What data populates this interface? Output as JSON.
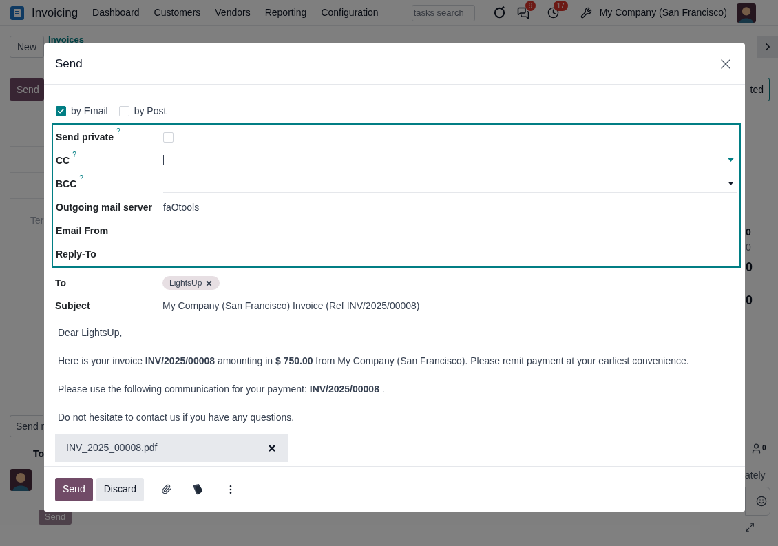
{
  "navbar": {
    "app_name": "Invoicing",
    "menu": [
      "Dashboard",
      "Customers",
      "Vendors",
      "Reporting",
      "Configuration"
    ],
    "search": {
      "placeholder": "tasks search"
    },
    "message_count": "9",
    "activity_count": "17",
    "company": "My Company (San Francisco)"
  },
  "background": {
    "new_button": "New",
    "breadcrumb": "Invoices",
    "send_button": "Send",
    "status_button": "ted",
    "left_text": "Ter",
    "right_values": [
      {
        "text": "0",
        "kind": "bold"
      },
      {
        "text": "0",
        "kind": "muted"
      },
      {
        "text": "0",
        "kind": "large"
      },
      {
        "text": "0",
        "kind": "large"
      }
    ],
    "send_message_button": "Send r",
    "to_label": "To",
    "followers_count": "0",
    "right_caption": "ately",
    "chatter_send_button": "Send"
  },
  "modal": {
    "title": "Send",
    "methods": [
      {
        "label": "by Email",
        "checked": true
      },
      {
        "label": "by Post",
        "checked": false
      }
    ],
    "advanced": [
      {
        "kind": "checkbox",
        "label": "Send private",
        "help": "?",
        "checked": false
      },
      {
        "kind": "select",
        "label": "CC",
        "help": "?",
        "focused": true
      },
      {
        "kind": "select",
        "label": "BCC",
        "help": "?",
        "focused": false
      },
      {
        "kind": "text",
        "label": "Outgoing mail server",
        "value": "faOtools"
      },
      {
        "kind": "text",
        "label": "Email From"
      },
      {
        "kind": "text",
        "label": "Reply-To"
      }
    ],
    "to": {
      "label": "To",
      "tags": [
        "LightsUp"
      ]
    },
    "subject": {
      "label": "Subject",
      "value": "My Company (San Francisco) Invoice (Ref INV/2025/00008)"
    },
    "body": [
      "Dear LightsUp,",
      "Here is your invoice **INV/2025/00008** amounting in **$ 750.00** from My Company (San Francisco). Please remit payment at your earliest convenience.",
      "Please use the following communication for your payment: **INV/2025/00008** .",
      "Do not hesitate to contact us if you have any questions."
    ],
    "attachments": [
      "INV_2025_00008.pdf"
    ],
    "footer_buttons": [
      {
        "label": "Send",
        "kind": "primary"
      },
      {
        "label": "Discard",
        "kind": "secondary"
      }
    ]
  }
}
